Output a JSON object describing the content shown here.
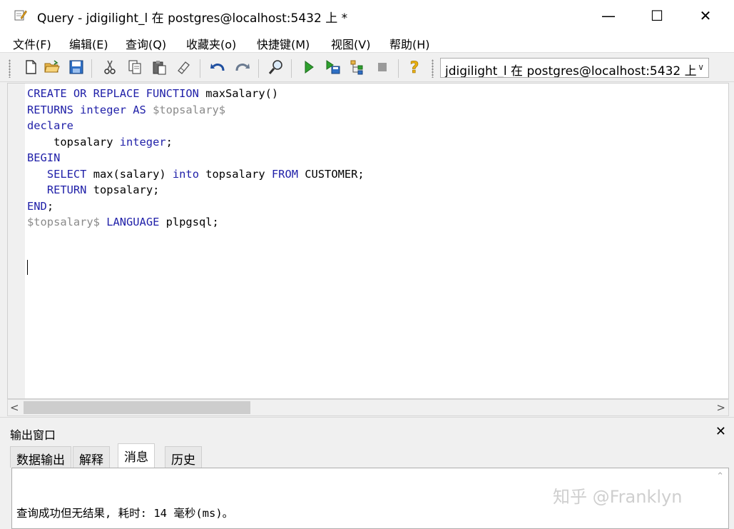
{
  "window": {
    "title": "Query - jdigilight_l 在  postgres@localhost:5432 上 *",
    "minimize": "—",
    "maximize": "☐",
    "close": "✕"
  },
  "menu": [
    "文件(F)",
    "编辑(E)",
    "查询(Q)",
    "收藏夹(o)",
    "快捷键(M)",
    "视图(V)",
    "帮助(H)"
  ],
  "toolbar": {
    "connection": "jdigilight_l 在  postgres@localhost:5432 上",
    "icons": [
      "new-file-icon",
      "open-folder-icon",
      "save-icon",
      "cut-icon",
      "copy-icon",
      "paste-icon",
      "clear-icon",
      "undo-icon",
      "redo-icon",
      "find-icon",
      "execute-icon",
      "execute-to-file-icon",
      "explain-icon",
      "stop-icon",
      "help-icon"
    ]
  },
  "editor": {
    "lines": [
      "CREATE OR REPLACE FUNCTION maxSalary()",
      "RETURNS integer AS $topsalary$",
      "declare",
      "    topsalary integer;",
      "BEGIN",
      "   SELECT max(salary) into topsalary FROM CUSTOMER;",
      "   RETURN topsalary;",
      "END;",
      "$topsalary$ LANGUAGE plpgsql;"
    ]
  },
  "scrollbar": {
    "left": "<",
    "right": ">"
  },
  "output": {
    "title": "输出窗口",
    "close": "✕",
    "tabs": [
      "数据输出",
      "解释",
      "消息",
      "历史"
    ],
    "active_tab": "消息",
    "message": "查询成功但无结果, 耗时: 14 毫秒(ms)。"
  },
  "watermark": "知乎 @Franklyn"
}
